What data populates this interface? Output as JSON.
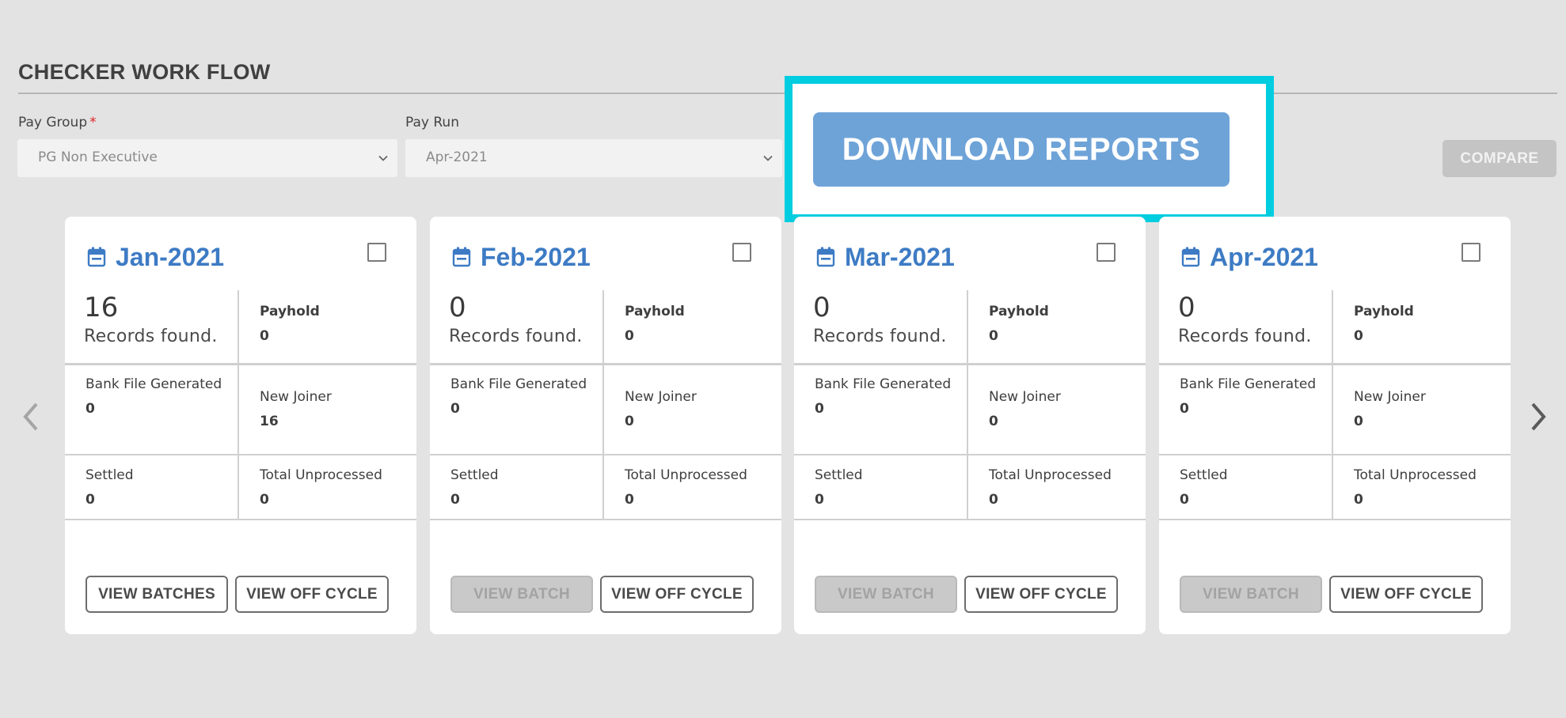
{
  "page": {
    "title": "CHECKER WORK FLOW"
  },
  "filters": {
    "pay_group": {
      "label": "Pay Group",
      "required_mark": "*",
      "value": "PG Non Executive"
    },
    "pay_run": {
      "label": "Pay Run",
      "value": "Apr-2021"
    }
  },
  "actions": {
    "download_reports": "DOWNLOAD REPORTS",
    "compare": "COMPARE"
  },
  "card_labels": {
    "records_found": "Records found.",
    "payhold": "Payhold",
    "bank_file_generated": "Bank File Generated",
    "new_joiner": "New Joiner",
    "settled": "Settled",
    "total_unprocessed": "Total Unprocessed"
  },
  "cards": [
    {
      "month": "Jan-2021",
      "records": "16",
      "payhold": "0",
      "bank_file_generated": "0",
      "new_joiner": "16",
      "settled": "0",
      "total_unprocessed": "0",
      "primary_button": "VIEW BATCHES",
      "primary_enabled": true,
      "secondary_button": "VIEW OFF CYCLE"
    },
    {
      "month": "Feb-2021",
      "records": "0",
      "payhold": "0",
      "bank_file_generated": "0",
      "new_joiner": "0",
      "settled": "0",
      "total_unprocessed": "0",
      "primary_button": "VIEW BATCH",
      "primary_enabled": false,
      "secondary_button": "VIEW OFF CYCLE"
    },
    {
      "month": "Mar-2021",
      "records": "0",
      "payhold": "0",
      "bank_file_generated": "0",
      "new_joiner": "0",
      "settled": "0",
      "total_unprocessed": "0",
      "primary_button": "VIEW BATCH",
      "primary_enabled": false,
      "secondary_button": "VIEW OFF CYCLE"
    },
    {
      "month": "Apr-2021",
      "records": "0",
      "payhold": "0",
      "bank_file_generated": "0",
      "new_joiner": "0",
      "settled": "0",
      "total_unprocessed": "0",
      "primary_button": "VIEW BATCH",
      "primary_enabled": false,
      "secondary_button": "VIEW OFF CYCLE"
    }
  ],
  "icons": {
    "calendar": "calendar-icon",
    "prev": "chevron-left-icon",
    "next": "chevron-right-icon",
    "dropdown": "chevron-down-icon"
  },
  "colors": {
    "accent_blue": "#3d7bc4",
    "download_button": "#6ea3d8",
    "highlight_frame": "#00cddf",
    "required": "#e0242b",
    "background": "#e3e3e3"
  }
}
